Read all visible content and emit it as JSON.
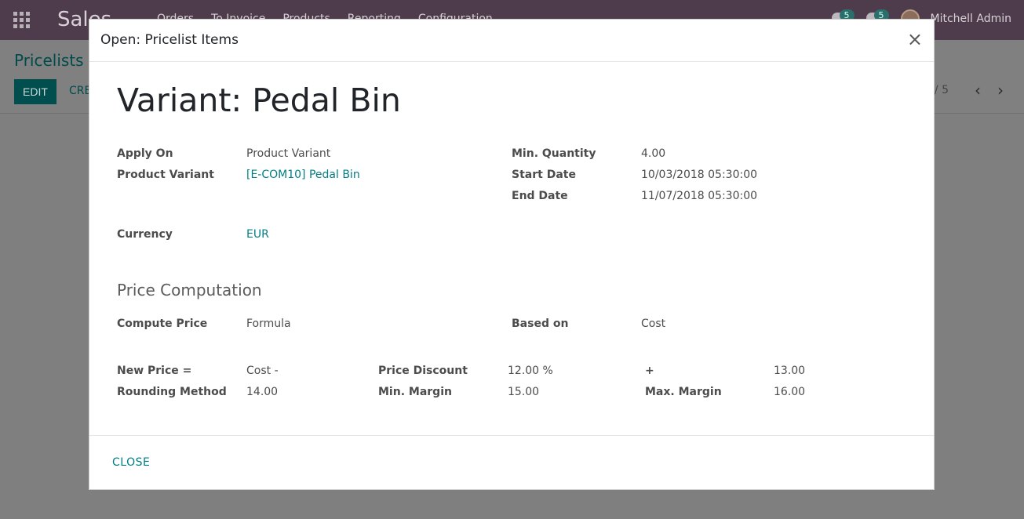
{
  "navbar": {
    "app_title": "Sales",
    "menu": [
      "Orders",
      "To Invoice",
      "Products",
      "Reporting",
      "Configuration"
    ],
    "messages_count": "5",
    "activities_count": "5",
    "user_name": "Mitchell Admin"
  },
  "control_panel": {
    "breadcrumb": "Pricelists /",
    "edit_label": "EDIT",
    "create_label": "CREATE",
    "pager_text": "/ 5"
  },
  "modal": {
    "title": "Open: Pricelist Items",
    "close_symbol": "×",
    "record_title": "Variant: Pedal Bin",
    "fields": {
      "apply_on_label": "Apply On",
      "apply_on_value": "Product Variant",
      "product_variant_label": "Product Variant",
      "product_variant_value": "[E-COM10] Pedal Bin",
      "min_quantity_label": "Min. Quantity",
      "min_quantity_value": "4.00",
      "start_date_label": "Start Date",
      "start_date_value": "10/03/2018 05:30:00",
      "end_date_label": "End Date",
      "end_date_value": "11/07/2018 05:30:00",
      "currency_label": "Currency",
      "currency_value": "EUR"
    },
    "price_computation": {
      "section_title": "Price Computation",
      "compute_price_label": "Compute Price",
      "compute_price_value": "Formula",
      "based_on_label": "Based on",
      "based_on_value": "Cost",
      "new_price_label": "New Price =",
      "new_price_value": "Cost -",
      "price_discount_label": "Price Discount",
      "price_discount_value": "12.00 %",
      "plus_label": "+",
      "plus_value": "13.00",
      "rounding_method_label": "Rounding Method",
      "rounding_method_value": "14.00",
      "min_margin_label": "Min. Margin",
      "min_margin_value": "15.00",
      "max_margin_label": "Max. Margin",
      "max_margin_value": "16.00"
    },
    "footer": {
      "close_label": "CLOSE"
    }
  },
  "colors": {
    "navbar_bg": "#4e3b4b",
    "accent_link": "#017e84",
    "backdrop": "#7f7f7f"
  },
  "icons": [
    "apps-icon",
    "close-icon",
    "chat-icon",
    "clock-icon",
    "chevron-left-icon",
    "chevron-right-icon",
    "avatar"
  ]
}
